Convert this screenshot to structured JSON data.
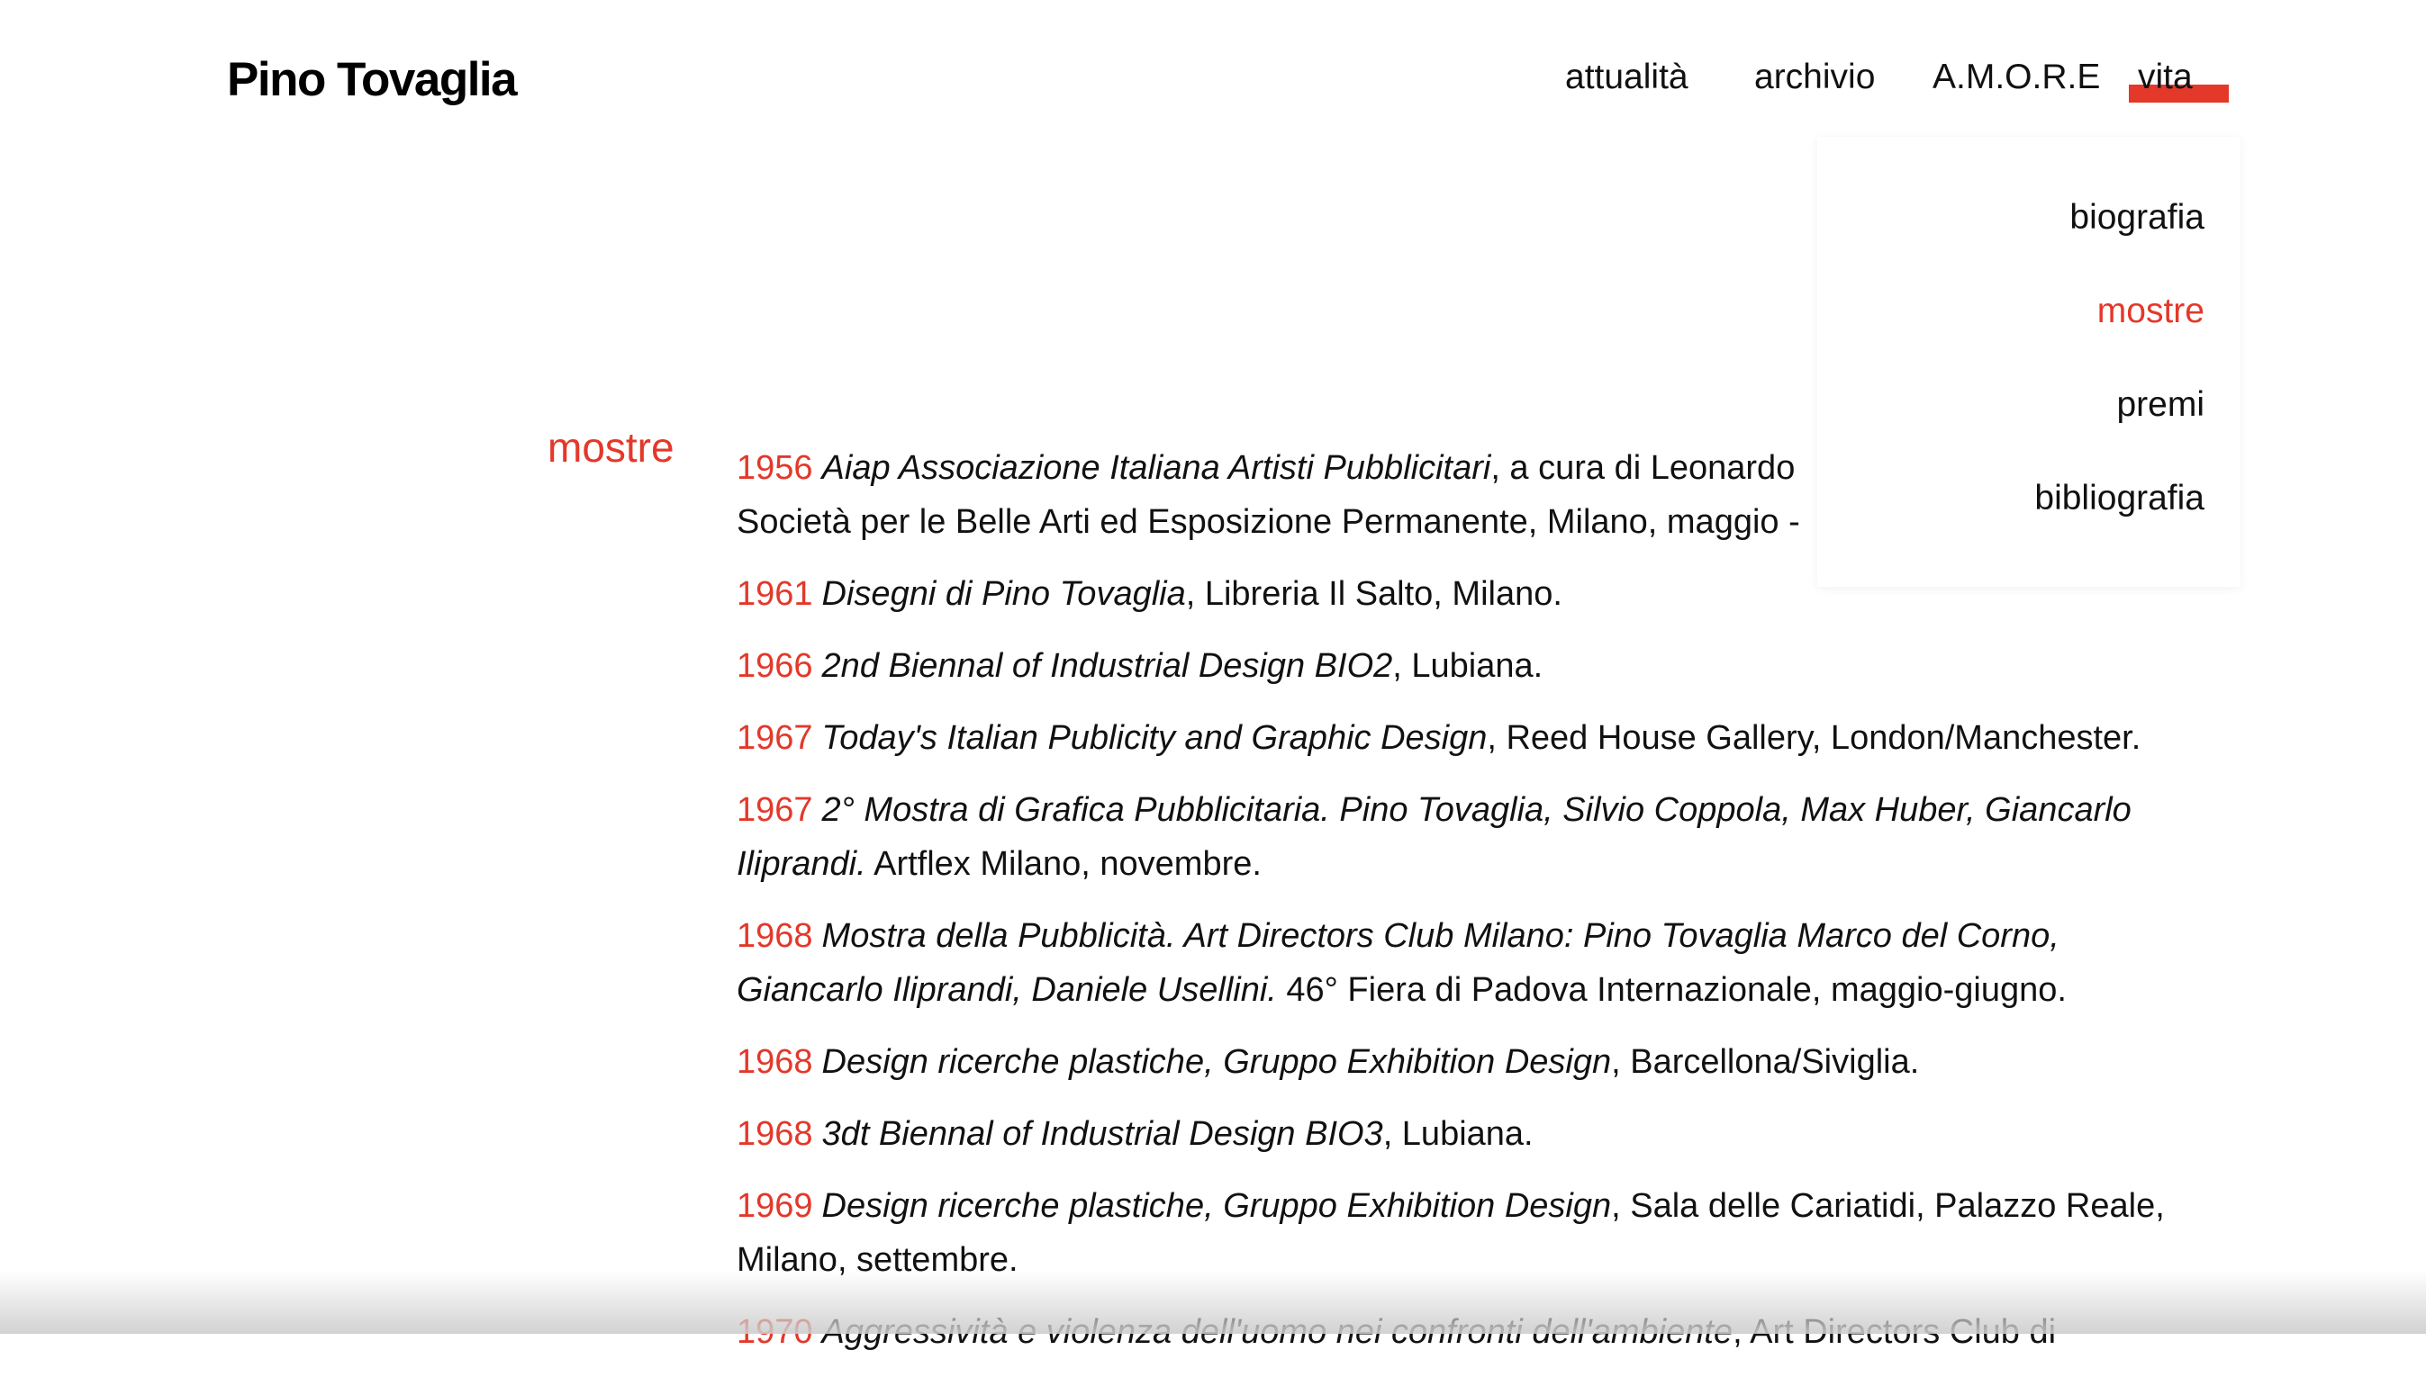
{
  "colors": {
    "accent": "#e3382a",
    "text": "#111111",
    "background": "#ffffff"
  },
  "site": {
    "logo": "Pino Tovaglia"
  },
  "nav": {
    "items": [
      {
        "label": "attualità"
      },
      {
        "label": "archivio"
      },
      {
        "label": "A.M.O.R.E"
      },
      {
        "label": "vita",
        "active": true
      }
    ]
  },
  "submenu": {
    "items": [
      {
        "label": "biografia"
      },
      {
        "label": "mostre",
        "selected": true
      },
      {
        "label": "premi"
      },
      {
        "label": "bibliografia"
      }
    ]
  },
  "section": {
    "label": "mostre"
  },
  "exhibitions": [
    {
      "year": "1956",
      "title": "Aiap Associazione Italiana Artisti Pubblicitari",
      "details": ", a cura di Leonardo"
    },
    {
      "year": "",
      "title": "",
      "details": "Società per le Belle Arti ed Esposizione Permanente, Milano, maggio -"
    },
    {
      "year": "1961",
      "title": "Disegni di Pino Tovaglia",
      "details": ", Libreria Il Salto, Milano."
    },
    {
      "year": "1966",
      "title": "2nd Biennal of Industrial Design BIO2",
      "details": ", Lubiana."
    },
    {
      "year": "1967",
      "title": "Today's Italian Publicity and Graphic Design",
      "details": ", Reed House Gallery, London/Manchester."
    },
    {
      "year": "1967",
      "title": "2° Mostra di Grafica Pubblicitaria. Pino Tovaglia, Silvio Coppola, Max Huber, Giancarlo Iliprandi.",
      "details": " Artflex Milano, novembre."
    },
    {
      "year": "1968",
      "title": "Mostra della Pubblicità. Art Directors Club Milano: Pino Tovaglia Marco del Corno, Giancarlo Iliprandi, Daniele Usellini.",
      "details": " 46° Fiera di Padova Internazionale, maggio-giugno."
    },
    {
      "year": "1968",
      "title": "Design ricerche plastiche, Gruppo Exhibition Design",
      "details": ", Barcellona/Siviglia."
    },
    {
      "year": "1968",
      "title": "3dt Biennal of Industrial Design BIO3",
      "details": ", Lubiana."
    },
    {
      "year": "1969",
      "title": "Design ricerche plastiche, Gruppo Exhibition Design",
      "details": ", Sala delle Cariatidi, Palazzo Reale, Milano, settembre."
    },
    {
      "year": "1970",
      "title": "Aggressività e violenza dell'uomo nei confronti dell'ambiente",
      "details": ", Art Directors Club di"
    }
  ]
}
